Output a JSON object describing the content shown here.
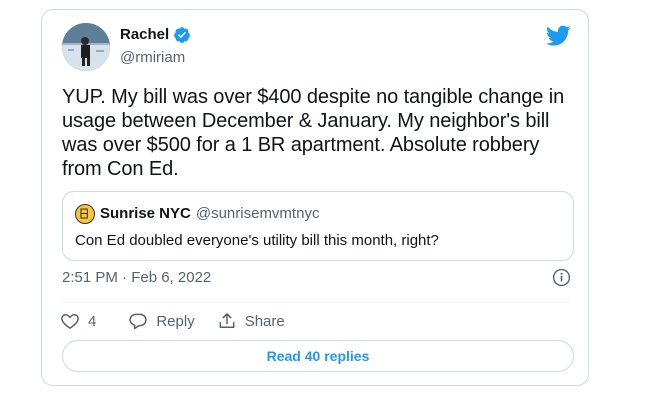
{
  "author": {
    "display_name": "Rachel",
    "handle": "@rmiriam",
    "verified": true
  },
  "tweet": {
    "text": "YUP. My bill was over $400 despite no tangible change in\nusage between December & January. My neighbor's bill\nwas over $500 for a 1 BR apartment. Absolute robbery\nfrom Con Ed.",
    "timestamp": "2:51 PM · Feb 6, 2022"
  },
  "quoted_tweet": {
    "display_name": "Sunrise NYC",
    "handle": "@sunrisemvmtnyc",
    "text": "Con Ed doubled everyone's utility bill this month, right?"
  },
  "actions": {
    "like_count": "4",
    "reply_label": "Reply",
    "share_label": "Share"
  },
  "read_replies_label": "Read 40 replies",
  "colors": {
    "accent": "#1d9bf0",
    "secondary_text": "#536471",
    "border": "#cfd9de"
  },
  "icons": [
    "twitter-bird-icon",
    "verified-badge-icon",
    "info-icon",
    "heart-icon",
    "reply-icon",
    "share-icon"
  ]
}
